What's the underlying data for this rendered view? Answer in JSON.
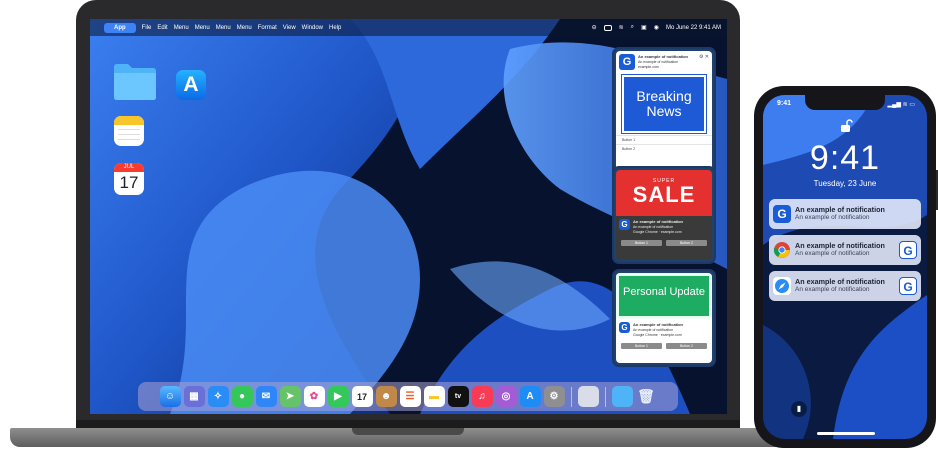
{
  "mac": {
    "menubar": {
      "apple": "",
      "app": "App",
      "items": [
        "File",
        "Edit",
        "Menu",
        "Menu",
        "Menu",
        "Menu",
        "Format",
        "View",
        "Window",
        "Help"
      ],
      "clock": "Mo June 22  9:41 AM"
    },
    "calendar_icon": {
      "month": "JUL",
      "day": "17"
    },
    "cards": {
      "breaking": {
        "title": "An example of notification",
        "body": "An example of notification",
        "site": "example.com",
        "banner": "Breaking News",
        "button1": "Button 1",
        "button2": "Button 2"
      },
      "sale": {
        "super": "SUPER",
        "sale": "SALE",
        "title": "An example of notification",
        "body": "An example of notification",
        "site": "Google Chrome · example.com",
        "button1": "Button 1",
        "button2": "Button 2"
      },
      "personal": {
        "banner": "Personal Update",
        "title": "An example of notification",
        "body": "An example of notification",
        "site": "Google Chrome · example.com",
        "button1": "Button 1",
        "button2": "Button 2"
      }
    },
    "dock": {
      "calendar_day": "17",
      "tv_label": "tv"
    }
  },
  "phone": {
    "status_time": "9:41",
    "clock": "9:41",
    "date": "Tuesday, 23 June",
    "notifications": [
      {
        "title": "An example of notification",
        "body": "An example of notification",
        "app": "app-logo"
      },
      {
        "title": "An example of notification",
        "body": "An example of notification",
        "app": "chrome"
      },
      {
        "title": "An example of notification",
        "body": "An example of notification",
        "app": "safari"
      }
    ]
  },
  "colors": {
    "brand": "#1a5bd6",
    "sale_red": "#e53030",
    "personal_green": "#1eab62",
    "wallpaper_blue": "#2f6fe0"
  }
}
